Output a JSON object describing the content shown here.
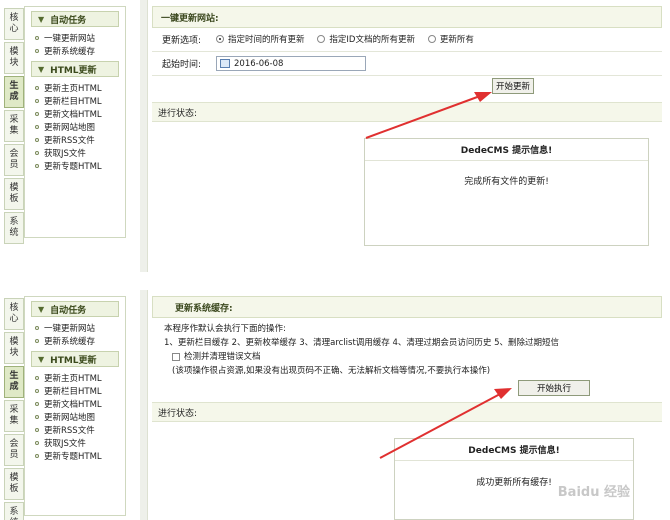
{
  "tabs": [
    "核心",
    "模块",
    "生成",
    "采集",
    "会员",
    "模板",
    "系统"
  ],
  "active_tab": "生成",
  "menu": {
    "group1": "自动任务",
    "group1_items": [
      "一键更新网站",
      "更新系统缓存"
    ],
    "group2": "HTML更新",
    "group2_items": [
      "更新主页HTML",
      "更新栏目HTML",
      "更新文档HTML",
      "更新网站地图",
      "更新RSS文件",
      "获取JS文件",
      "更新专题HTML"
    ]
  },
  "panel1": {
    "header": "一键更新网站:",
    "update_label": "更新选项:",
    "radios": [
      "指定时间的所有更新",
      "指定ID文档的所有更新",
      "更新所有"
    ],
    "start_label": "起始时间:",
    "start_date": "2016-06-08",
    "start_button": "开始更新",
    "status_label": "进行状态:",
    "msg_title": "DedeCMS 提示信息!",
    "msg_body": "完成所有文件的更新!"
  },
  "panel2": {
    "header": "更新系统缓存:",
    "desc": "本程序作默认会执行下面的操作:",
    "ops": "1、更新栏目缓存 2、更新枚举缓存 3、清理arclist调用缓存 4、清理过期会员访问历史 5、删除过期短信",
    "check_label": "检测并清理错误文档",
    "note": "(该项操作很占资源,如果没有出现页码不正确、无法解析文档等情况,不要执行本操作)",
    "exec_button": "开始执行",
    "status_label": "进行状态:",
    "msg_title": "DedeCMS 提示信息!",
    "msg_body": "成功更新所有缓存!"
  },
  "watermark": "Baidu 经验"
}
